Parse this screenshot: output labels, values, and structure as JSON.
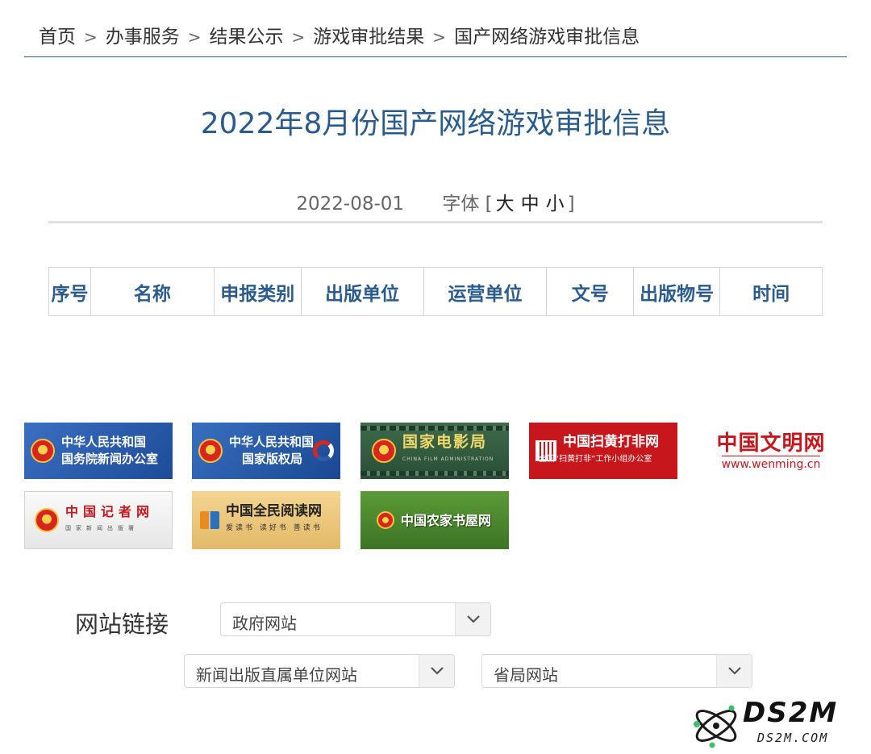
{
  "breadcrumb": {
    "items": [
      "首页",
      "办事服务",
      "结果公示",
      "游戏审批结果",
      "国产网络游戏审批信息"
    ],
    "separator": ">"
  },
  "article": {
    "title": "2022年8月份国产网络游戏审批信息",
    "date": "2022-08-01",
    "font_size_label": "字体",
    "bracket_open": "[",
    "bracket_close": "]",
    "font_sizes": [
      "大",
      "中",
      "小"
    ]
  },
  "table": {
    "headers": [
      "序号",
      "名称",
      "申报类别",
      "出版单位",
      "运营单位",
      "文号",
      "出版物号",
      "时间"
    ],
    "rows": []
  },
  "logos": [
    {
      "lines": [
        "中华人民共和国",
        "国务院新闻办公室"
      ]
    },
    {
      "lines": [
        "中华人民共和国",
        "国家版权局"
      ]
    },
    {
      "lines": [
        "国家电影局"
      ],
      "sub": "CHINA FILM ADMINISTRATION"
    },
    {
      "lines": [
        "中国扫黄打非网"
      ],
      "sub": "全国“扫黄打非”工作小组办公室"
    },
    {
      "lines": [
        "中国文明网"
      ],
      "sub": "www.wenming.cn"
    },
    {
      "lines": [
        "中国记者网"
      ],
      "sub": "国家新闻出版署"
    },
    {
      "lines": [
        "中国全民阅读网"
      ],
      "sub": "爱读书 读好书 善读书"
    },
    {
      "lines": [
        "中国农家书屋网"
      ]
    }
  ],
  "links": {
    "label": "网站链接",
    "selects": [
      "政府网站",
      "新闻出版直属单位网站",
      "省局网站"
    ]
  },
  "watermark": {
    "main": "DS2M",
    "sub": "DS2M.COM"
  },
  "colors": {
    "title_blue": "#2a5b8f",
    "rule_blue": "#2d5d86",
    "logo_red": "#c8161d"
  }
}
